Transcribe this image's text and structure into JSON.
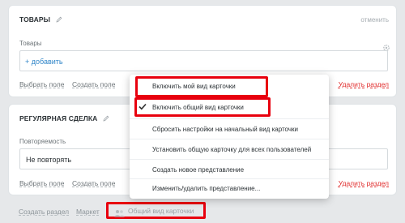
{
  "goods_section": {
    "title": "ТОВАРЫ",
    "cancel_label": "отменить",
    "field_label": "Товары",
    "add_label": "+ добавить",
    "select_field_label": "Выбрать поле",
    "create_field_label": "Создать поле",
    "delete_section_label": "Удалить раздел"
  },
  "deal_section": {
    "title": "РЕГУЛЯРНАЯ СДЕЛКА",
    "field_label": "Повторяемость",
    "field_value": "Не повторять",
    "select_field_label": "Выбрать поле",
    "create_field_label": "Создать поле",
    "delete_section_label": "Удалить раздел"
  },
  "footer": {
    "create_section_label": "Создать раздел",
    "market_label": "Маркет",
    "general_card_label": "Общий вид карточки"
  },
  "menu": {
    "items": [
      {
        "label": "Включить мой вид карточки"
      },
      {
        "label": "Включить общий вид карточки"
      },
      {
        "label": "Сбросить настройки на начальный вид карточки"
      },
      {
        "label": "Установить общую карточку для всех пользователей"
      },
      {
        "label": "Создать новое представление"
      },
      {
        "label": "Изменить/удалить представление..."
      }
    ]
  },
  "colors": {
    "highlight": "#e8000e",
    "link_blue": "#2f85c8",
    "delete_red": "#e02d2d"
  }
}
